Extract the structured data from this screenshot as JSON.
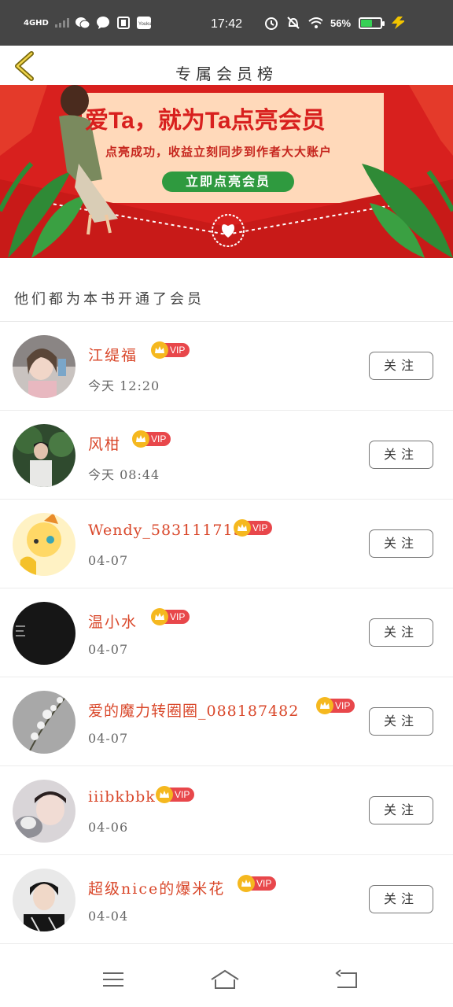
{
  "status_bar": {
    "network": "4GHD",
    "time": "17:42",
    "battery": "56%"
  },
  "header": {
    "title": "专属会员榜"
  },
  "banner": {
    "headline": "爱Ta，就为Ta点亮会员",
    "subtitle": "点亮成功，收益立刻同步到作者大大账户",
    "cta": "立即点亮会员"
  },
  "section": {
    "title": "他们都为本书开通了会员"
  },
  "vip_label": "VIP",
  "follow_label": "关注",
  "members": [
    {
      "name": "江缇福",
      "time": "今天 12:20"
    },
    {
      "name": "风柑",
      "time": "今天 08:44"
    },
    {
      "name": "Wendy_583111715",
      "time": "04-07"
    },
    {
      "name": "温小水",
      "time": "04-07"
    },
    {
      "name": "爱的魔力转圈圈_088187482",
      "time": "04-07"
    },
    {
      "name": "iiibkbbk",
      "time": "04-06"
    },
    {
      "name": "超级nice的爆米花",
      "time": "04-04"
    }
  ],
  "colors": {
    "accent": "#d9472a",
    "banner_red": "#d8201e",
    "vip_red": "#e8474b",
    "crown_gold": "#f5b81f"
  }
}
